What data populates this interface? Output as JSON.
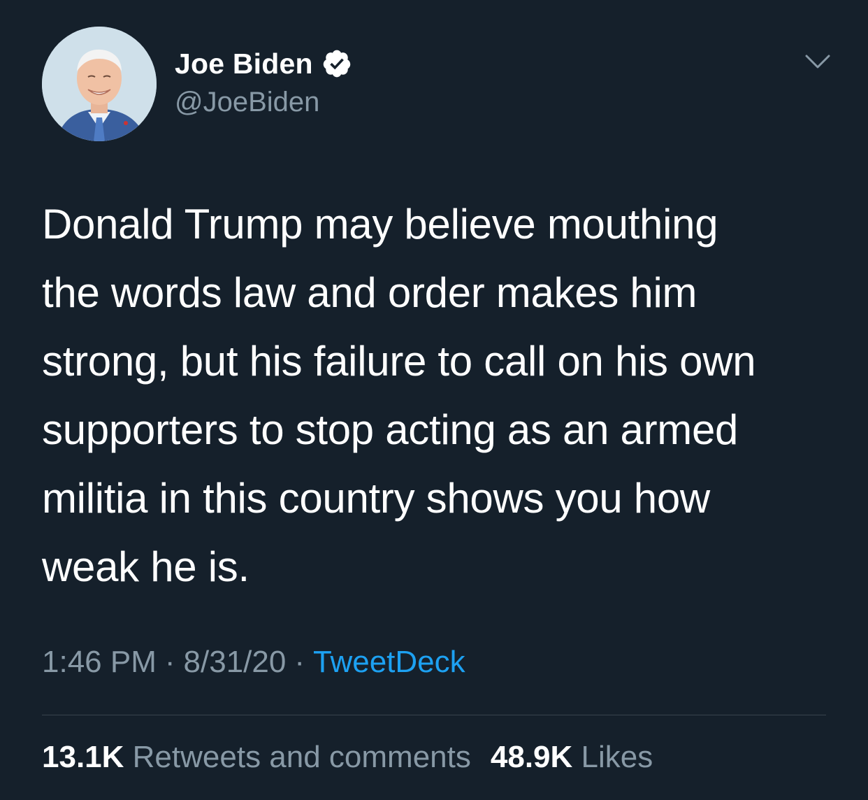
{
  "author": {
    "display_name": "Joe Biden",
    "handle": "@JoeBiden",
    "verified": true
  },
  "tweet": {
    "text": "Donald Trump may believe mouthing\nthe words law and order makes him\nstrong, but his failure to call on his own\nsupporters to stop acting as an armed\nmilitia in this country shows you how\nweak he is.",
    "time": "1:46 PM",
    "date": "8/31/20",
    "separator": "·",
    "source": "TweetDeck"
  },
  "stats": {
    "retweets_count": "13.1K",
    "retweets_label": "Retweets and comments",
    "likes_count": "48.9K",
    "likes_label": "Likes"
  },
  "icons": {
    "verified": "verified-badge-icon",
    "more": "chevron-down-icon"
  },
  "colors": {
    "background": "#15202b",
    "text": "#ffffff",
    "secondary": "#8899a6",
    "accent": "#1da1f2",
    "divider": "#38444d"
  }
}
